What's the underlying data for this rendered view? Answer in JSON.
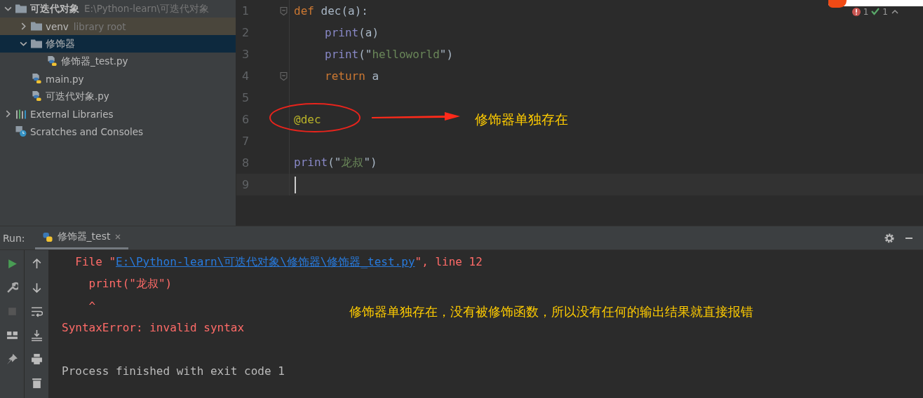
{
  "project_tree": [
    {
      "label": "可迭代对象",
      "hint": "E:\\Python-learn\\可迭代对象",
      "kind": "folder",
      "expanded": true,
      "selected": false,
      "children": [
        {
          "label": "venv",
          "hint": "library root",
          "kind": "folder",
          "expanded": false,
          "selected": false,
          "library": true
        },
        {
          "label": "修饰器",
          "kind": "folder",
          "expanded": true,
          "selected": true,
          "children": [
            {
              "label": "修饰器_test.py",
              "kind": "python",
              "selected": false
            }
          ]
        },
        {
          "label": "main.py",
          "kind": "python",
          "selected": false
        },
        {
          "label": "可迭代对象.py",
          "kind": "python",
          "selected": false
        }
      ]
    },
    {
      "label": "External Libraries",
      "kind": "libraries",
      "expanded": false,
      "selected": false
    },
    {
      "label": "Scratches and Consoles",
      "kind": "scratches",
      "selected": false
    }
  ],
  "editor": {
    "inspections": {
      "errors": "1",
      "ok": "1"
    },
    "lines": [
      {
        "number": "1",
        "tokens": [
          {
            "kind": "kw",
            "t": "def "
          },
          {
            "kind": "plain",
            "t": "dec(a):"
          }
        ],
        "fold": true
      },
      {
        "number": "2",
        "indented": true,
        "tokens": [
          {
            "kind": "fn",
            "t": "print"
          },
          {
            "kind": "plain",
            "t": "(a)"
          }
        ]
      },
      {
        "number": "3",
        "indented": true,
        "tokens": [
          {
            "kind": "fn",
            "t": "print"
          },
          {
            "kind": "plain",
            "t": "(\""
          },
          {
            "kind": "str",
            "t": "helloworld"
          },
          {
            "kind": "plain",
            "t": "\")"
          }
        ]
      },
      {
        "number": "4",
        "indented": true,
        "tokens": [
          {
            "kind": "kw",
            "t": "return "
          },
          {
            "kind": "plain",
            "t": "a"
          }
        ],
        "fold": true
      },
      {
        "number": "5"
      },
      {
        "number": "6",
        "tokens": [
          {
            "kind": "deco",
            "t": "@dec"
          }
        ]
      },
      {
        "number": "7"
      },
      {
        "number": "8",
        "tokens": [
          {
            "kind": "fn",
            "t": "print"
          },
          {
            "kind": "plain",
            "t": "(\""
          },
          {
            "kind": "str",
            "t": "龙叔"
          },
          {
            "kind": "plain",
            "t": "\")"
          }
        ]
      },
      {
        "number": "9",
        "current": true
      }
    ],
    "annotation": "修饰器单独存在"
  },
  "run_panel": {
    "label": "Run:",
    "tabs": [
      {
        "label": "修饰器_test",
        "selected": true
      }
    ],
    "output": [
      {
        "kind": "text",
        "segments": [
          {
            "kind": "err",
            "t": "  File \""
          },
          {
            "kind": "link",
            "t": "E:\\Python-learn\\可迭代对象\\修饰器\\修饰器_test.py"
          },
          {
            "kind": "err",
            "t": "\", line 12"
          }
        ]
      },
      {
        "kind": "text",
        "segments": [
          {
            "kind": "err",
            "t": "    print(\"龙叔\")"
          }
        ]
      },
      {
        "kind": "text",
        "segments": [
          {
            "kind": "err",
            "t": "    ^"
          }
        ]
      },
      {
        "kind": "text",
        "segments": [
          {
            "kind": "err",
            "t": "SyntaxError: invalid syntax"
          }
        ]
      },
      {
        "kind": "blank"
      },
      {
        "kind": "text",
        "segments": [
          {
            "kind": "normal",
            "t": "Process finished with exit code 1"
          }
        ]
      }
    ],
    "annotation": "修饰器单独存在，没有被修饰函数，所以没有任何的输出结果就直接报错"
  }
}
